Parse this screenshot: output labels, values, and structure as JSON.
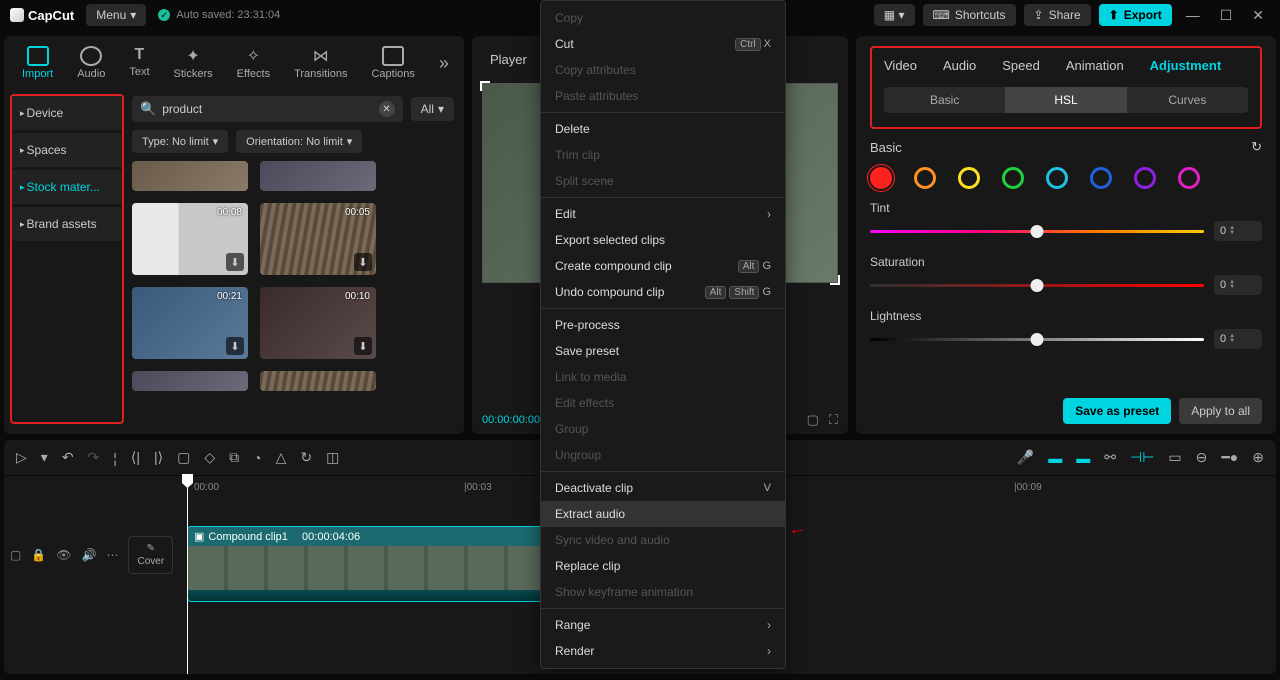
{
  "app": {
    "name": "CapCut",
    "menu": "Menu",
    "autosave": "Auto saved: 23:31:04"
  },
  "topbar": {
    "shortcuts": "Shortcuts",
    "share": "Share",
    "export": "Export"
  },
  "panel_tabs": [
    "Import",
    "Audio",
    "Text",
    "Stickers",
    "Effects",
    "Transitions",
    "Captions"
  ],
  "side_nav": [
    "Device",
    "Spaces",
    "Stock mater...",
    "Brand assets"
  ],
  "search": {
    "value": "product",
    "all": "All"
  },
  "filters": {
    "type": "Type: No limit",
    "orient": "Orientation: No limit"
  },
  "clips": [
    {
      "time": "00:08"
    },
    {
      "time": "00:05"
    },
    {
      "time": "00:21"
    },
    {
      "time": "00:10"
    }
  ],
  "player": {
    "title": "Player",
    "time": "00:00:00:00"
  },
  "adjustment": {
    "tabs": [
      "Video",
      "Audio",
      "Speed",
      "Animation",
      "Adjustment"
    ],
    "subtabs": [
      "Basic",
      "HSL",
      "Curves"
    ],
    "basic": "Basic",
    "sliders": {
      "tint": "Tint",
      "saturation": "Saturation",
      "lightness": "Lightness"
    },
    "values": {
      "tint": "0",
      "saturation": "0",
      "lightness": "0"
    },
    "colors": [
      "#ff2020",
      "#ff9020",
      "#ffe020",
      "#20d040",
      "#20c0e0",
      "#2060e0",
      "#9020e0",
      "#e020c0"
    ],
    "save": "Save as preset",
    "apply": "Apply to all"
  },
  "timeline": {
    "ticks": [
      "00:00",
      "00:03",
      "00:09"
    ],
    "clip": {
      "name": "Compound clip1",
      "dur": "00:00:04:06"
    },
    "cover": "Cover"
  },
  "context_menu": [
    {
      "label": "Copy",
      "disabled": true
    },
    {
      "label": "Cut",
      "shortcut": [
        "Ctrl",
        "X"
      ]
    },
    {
      "label": "Copy attributes",
      "disabled": true
    },
    {
      "label": "Paste attributes",
      "disabled": true
    },
    {
      "sep": true
    },
    {
      "label": "Delete"
    },
    {
      "label": "Trim clip",
      "disabled": true
    },
    {
      "label": "Split scene",
      "disabled": true
    },
    {
      "sep": true
    },
    {
      "label": "Edit",
      "submenu": true
    },
    {
      "label": "Export selected clips"
    },
    {
      "label": "Create compound clip",
      "shortcut": [
        "Alt",
        "G"
      ]
    },
    {
      "label": "Undo compound clip",
      "shortcut": [
        "Alt",
        "Shift",
        "G"
      ]
    },
    {
      "sep": true
    },
    {
      "label": "Pre-process"
    },
    {
      "label": "Save preset"
    },
    {
      "label": "Link to media",
      "disabled": true
    },
    {
      "label": "Edit effects",
      "disabled": true
    },
    {
      "label": "Group",
      "disabled": true
    },
    {
      "label": "Ungroup",
      "disabled": true
    },
    {
      "sep": true
    },
    {
      "label": "Deactivate clip",
      "shortcut_plain": "V"
    },
    {
      "label": "Extract audio",
      "highlight": true
    },
    {
      "label": "Sync video and audio",
      "disabled": true
    },
    {
      "label": "Replace clip"
    },
    {
      "label": "Show keyframe animation",
      "disabled": true
    },
    {
      "sep": true
    },
    {
      "label": "Range",
      "submenu": true
    },
    {
      "label": "Render",
      "submenu": true
    }
  ]
}
